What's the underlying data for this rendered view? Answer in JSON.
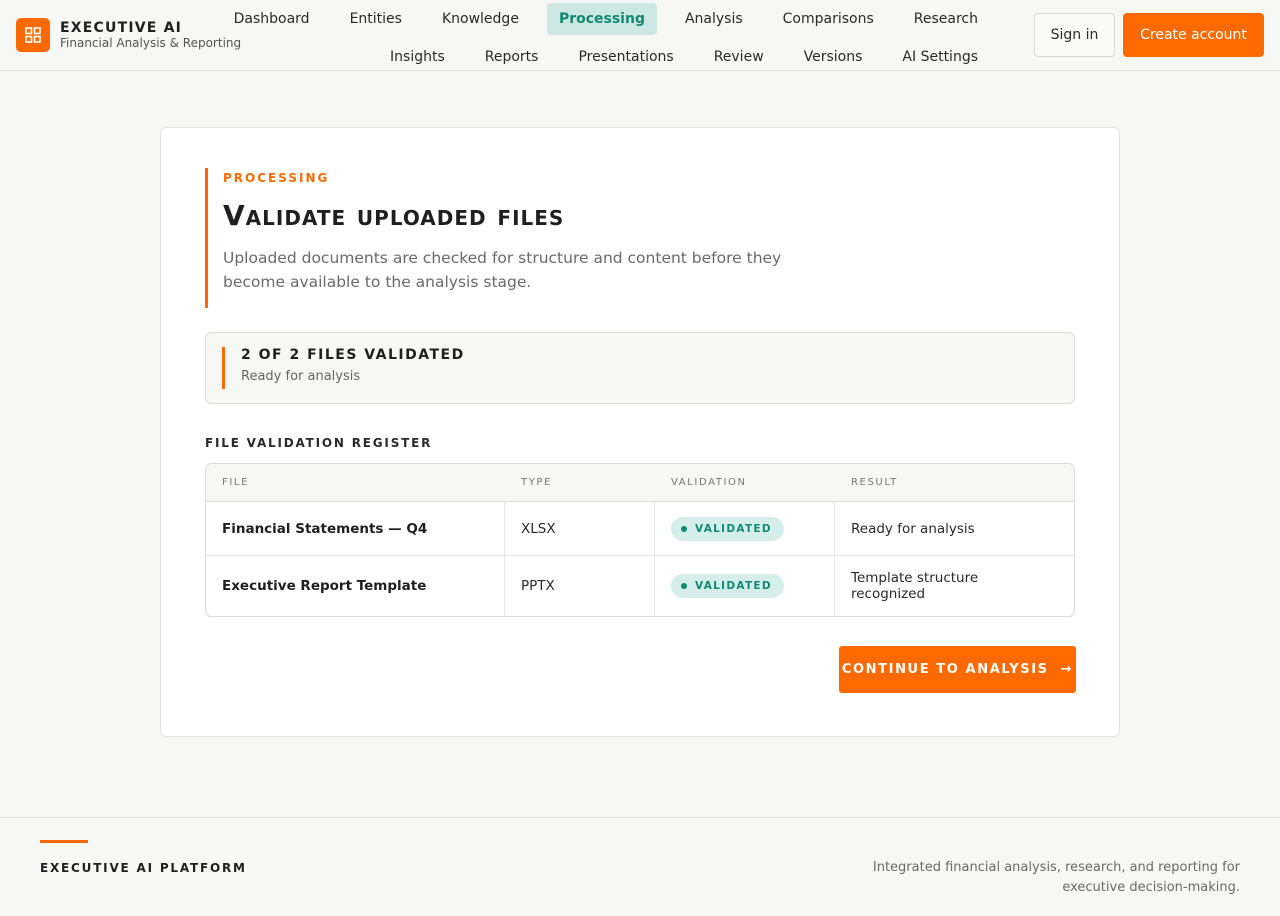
{
  "brand": {
    "name": "EXECUTIVE AI",
    "subtitle": "Financial Analysis & Reporting",
    "icon": "grid-icon",
    "accent_color": "#ff6a00"
  },
  "nav": {
    "row1": [
      "Dashboard",
      "Entities",
      "Knowledge",
      "Processing",
      "Analysis",
      "Comparisons",
      "Research"
    ],
    "row2": [
      "Insights",
      "Reports",
      "Presentations",
      "Review",
      "Versions",
      "AI Settings"
    ],
    "active": "Processing",
    "active_color": "#0e8a74"
  },
  "auth": {
    "sign_in": "Sign in",
    "create_account": "Create account"
  },
  "hero": {
    "eyebrow": "PROCESSING",
    "title": "Validate uploaded files",
    "description": "Uploaded documents are checked for structure and content before they become available to the analysis stage."
  },
  "summary": {
    "title": "2 OF 2 FILES VALIDATED",
    "subtitle": "Ready for analysis"
  },
  "register": {
    "label": "FILE VALIDATION REGISTER",
    "columns": [
      "FILE",
      "TYPE",
      "VALIDATION",
      "RESULT"
    ],
    "rows": [
      {
        "file": "Financial Statements — Q4",
        "type": "XLSX",
        "validation": "VALIDATED",
        "result": "Ready for analysis"
      },
      {
        "file": "Executive Report Template",
        "type": "PPTX",
        "validation": "VALIDATED",
        "result": "Template structure recognized"
      }
    ]
  },
  "actions": {
    "continue": "CONTINUE TO ANALYSIS",
    "continue_icon": "arrow-right-icon"
  },
  "footer": {
    "title": "EXECUTIVE AI PLATFORM",
    "description": "Integrated financial analysis, research, and reporting for executive decision-making."
  }
}
